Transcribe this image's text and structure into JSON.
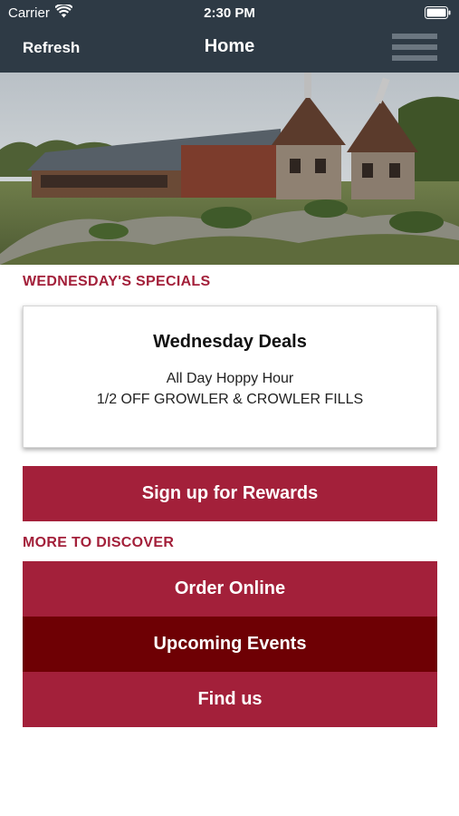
{
  "status_bar": {
    "carrier": "Carrier",
    "time": "2:30 PM"
  },
  "nav": {
    "refresh_label": "Refresh",
    "title": "Home",
    "menu_icon": "hamburger-menu-icon"
  },
  "specials": {
    "heading": "WEDNESDAY'S SPECIALS",
    "card": {
      "title": "Wednesday Deals",
      "lines": [
        "All Day Hoppy Hour",
        "1/2 OFF GROWLER & CROWLER FILLS"
      ]
    }
  },
  "rewards_button_label": "Sign up for Rewards",
  "discover": {
    "heading": "MORE TO DISCOVER",
    "buttons": [
      {
        "label": "Order Online"
      },
      {
        "label": "Upcoming Events"
      },
      {
        "label": "Find us"
      }
    ]
  },
  "colors": {
    "header_bg": "#2e3a45",
    "accent_red": "#a3203a",
    "dark_red": "#6e0004"
  }
}
